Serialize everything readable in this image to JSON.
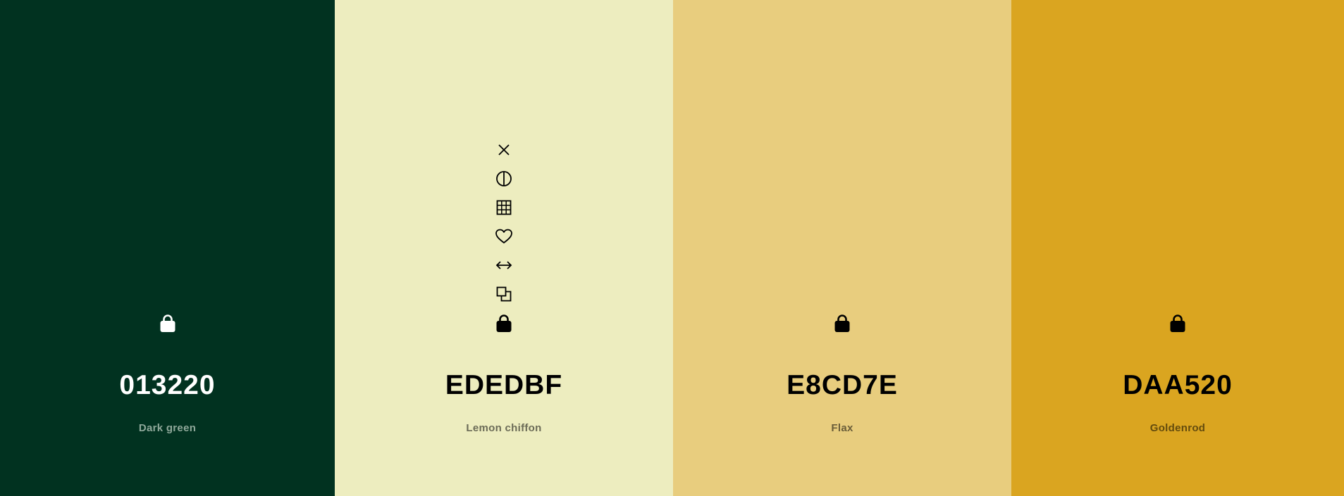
{
  "swatches": [
    {
      "hex": "013220",
      "name": "Dark green",
      "background": "#013220",
      "text_color": "#ffffff",
      "name_color": "#8fa89a",
      "lock_icon": "lock-icon",
      "locked": true
    },
    {
      "hex": "EDEDBF",
      "name": "Lemon chiffon",
      "background": "#EDEDBF",
      "text_color": "#000000",
      "name_color": "#6b6b57",
      "lock_icon": "lock-icon",
      "locked": true,
      "tools": [
        "close-icon",
        "contrast-icon",
        "grid-icon",
        "heart-icon",
        "arrows-horizontal-icon",
        "copy-icon"
      ]
    },
    {
      "hex": "E8CD7E",
      "name": "Flax",
      "background": "#E8CD7E",
      "text_color": "#000000",
      "name_color": "#6a5d39",
      "lock_icon": "lock-icon",
      "locked": true
    },
    {
      "hex": "DAA520",
      "name": "Goldenrod",
      "background": "#DAA520",
      "text_color": "#000000",
      "name_color": "#634b0e",
      "lock_icon": "lock-icon",
      "locked": true
    }
  ]
}
